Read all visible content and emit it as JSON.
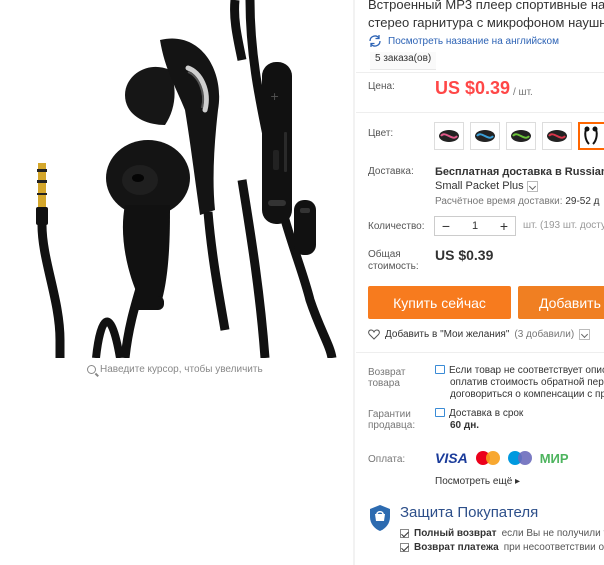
{
  "product": {
    "title_line1": "Встроенный MP3 плеер спортивные науш",
    "title_line2": "стерео гарнитура с микрофоном наушник",
    "translate_link": "Посмотреть название на английском",
    "orders": "5 заказа(ов)"
  },
  "price": {
    "label": "Цена:",
    "value": "US $0.39",
    "unit": "/ шт."
  },
  "color": {
    "label": "Цвет:",
    "options": [
      "pink",
      "blue",
      "green",
      "red",
      "black"
    ],
    "selected": "black"
  },
  "shipping": {
    "label": "Доставка:",
    "method_line1": "Бесплатная доставка в Russian Fed",
    "method_line2": "Small Packet Plus",
    "time_label": "Расчётное время доставки:",
    "time_value": "29-52 д"
  },
  "quantity": {
    "label": "Количество:",
    "minus": "−",
    "value": "1",
    "plus": "+",
    "available": "шт. (193 шт. доступ"
  },
  "total": {
    "label_line1": "Общая",
    "label_line2": "стоимость:",
    "value": "US $0.39"
  },
  "actions": {
    "buy_now": "Купить сейчас",
    "add_to_cart": "Добавить"
  },
  "wishlist": {
    "label": "Добавить в \"Мои желания\"",
    "count": "(3 добавили)"
  },
  "returns": {
    "label_line1": "Возврат",
    "label_line2": "товара",
    "line1": "Если товар не соответствует опис",
    "line2": "оплатив стоимость обратной пер",
    "line3": "договориться о компенсации с пр"
  },
  "seller_guarantee": {
    "label_line1": "Гарантии",
    "label_line2": "продавца:",
    "line1": "Доставка в срок",
    "line2": "60 дн."
  },
  "payment": {
    "label": "Оплата:",
    "methods": [
      "VISA",
      "mastercard",
      "maestro",
      "МИР"
    ],
    "more": "Посмотреть ещё"
  },
  "protection": {
    "title": "Защита Покупателя",
    "item1_bold": "Полный возврат",
    "item1_rest": "если Вы не получили то",
    "item2_bold": "Возврат платежа",
    "item2_rest": "при несоответствии опи"
  },
  "image": {
    "zoom_hint": "Наведите курсор, чтобы увеличить"
  },
  "colors": {
    "price_red": "#ff4747",
    "buy_orange": "#f77b1e",
    "link_blue": "#2d63b5"
  }
}
